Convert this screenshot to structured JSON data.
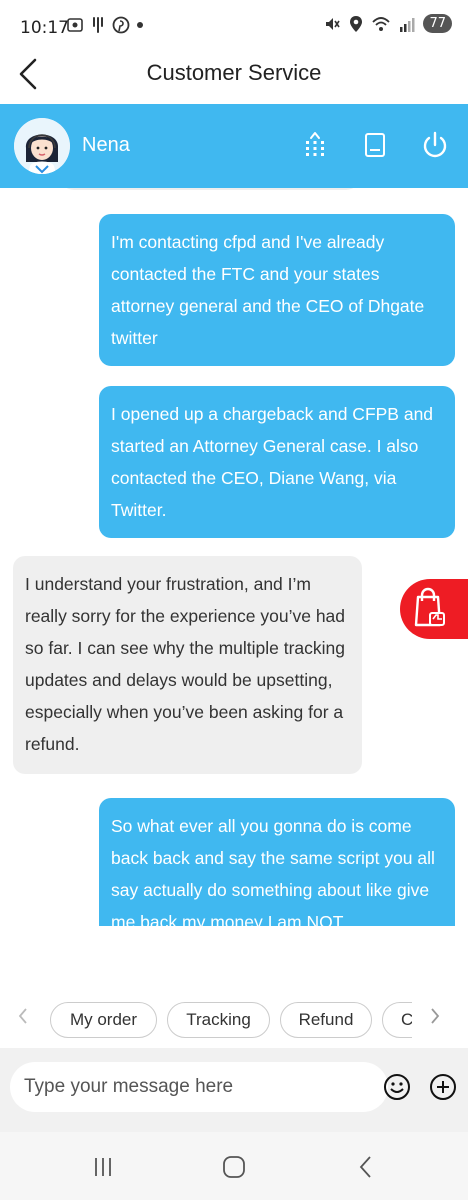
{
  "status_bar": {
    "time": "10:17",
    "battery": "77",
    "left_icons": [
      "screenshot-icon",
      "vibrate-icon",
      "pinterest-icon",
      "dot-icon"
    ],
    "right_icons": [
      "mute-icon",
      "location-icon",
      "wifi-icon",
      "signal-icon"
    ]
  },
  "header": {
    "title": "Customer Service",
    "back_icon": "chevron-left-icon"
  },
  "agent": {
    "name": "Nena",
    "icons": [
      "menu-grid-icon",
      "minimize-window-icon",
      "power-icon"
    ]
  },
  "messages": [
    {
      "sender": "user",
      "text": "I'm contacting cfpd and I've already contacted the FTC and your states attorney general and the CEO of Dhgate twitter"
    },
    {
      "sender": "user",
      "text": "I opened up a chargeback and CFPB and started an Attorney General case. I also contacted the CEO, Diane Wang, via Twitter."
    },
    {
      "sender": "agent",
      "text": "I understand your frustration, and I’m really sorry for the experience you’ve had so far. I can see why the multiple tracking updates and delays would be upsetting, especially when you’ve been asking for a refund."
    },
    {
      "sender": "user",
      "text": "So what ever all you gonna do is come back back and say the same script you all say actually do something about like give me back my money I am NOT"
    }
  ],
  "promo": {
    "icon": "shopping-bag-thumbs-up-icon"
  },
  "quick_replies": [
    "My order",
    "Tracking",
    "Refund",
    "Co"
  ],
  "input": {
    "placeholder": "Type your message here",
    "value": ""
  },
  "colors": {
    "accent": "#40b8f0",
    "agent_bubble": "#efefef",
    "promo": "#ee1c24"
  }
}
